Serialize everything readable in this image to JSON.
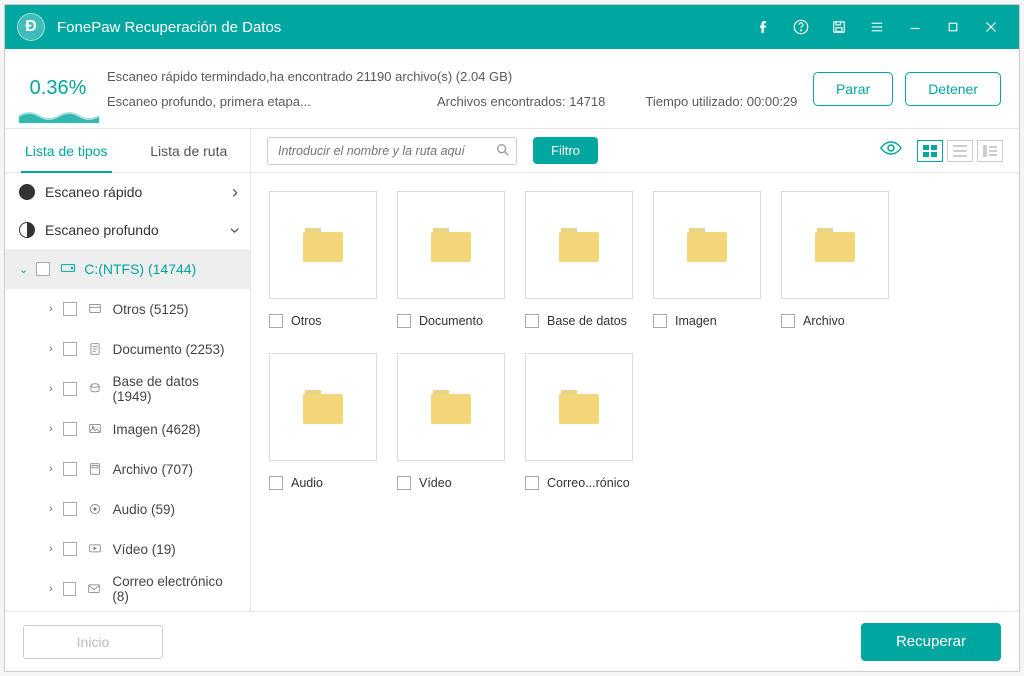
{
  "app": {
    "title": "FonePaw Recuperación de Datos"
  },
  "status": {
    "percent": "0.36%",
    "line1": "Escaneo rápido termindado,ha encontrado 21190 archivo(s) (2.04 GB)",
    "line2a": "Escaneo profundo, primera etapa...",
    "found_label": "Archivos encontrados: 14718",
    "time_label": "Tiempo utilizado: 00:00:29",
    "pause_label": "Parar",
    "stop_label": "Detener"
  },
  "sidebar": {
    "tab_types": "Lista de tipos",
    "tab_path": "Lista de ruta",
    "quick_scan": "Escaneo rápido",
    "deep_scan": "Escaneo profundo",
    "drive": "C:(NTFS) (14744)",
    "items": [
      {
        "label": "Otros (5125)"
      },
      {
        "label": "Documento (2253)"
      },
      {
        "label": "Base de datos (1949)"
      },
      {
        "label": "Imagen (4628)"
      },
      {
        "label": "Archivo (707)"
      },
      {
        "label": "Audio (59)"
      },
      {
        "label": "Vídeo (19)"
      },
      {
        "label": "Correo electrónico (8)"
      }
    ]
  },
  "toolbar": {
    "search_placeholder": "Introducir el nombre y la ruta aquí",
    "filter_label": "Filtro"
  },
  "folders": [
    {
      "label": "Otros"
    },
    {
      "label": "Documento"
    },
    {
      "label": "Base de datos"
    },
    {
      "label": "Imagen"
    },
    {
      "label": "Archivo"
    },
    {
      "label": "Audio"
    },
    {
      "label": "Vídeo"
    },
    {
      "label": "Correo...rónico"
    }
  ],
  "footer": {
    "start_label": "Inicio",
    "recover_label": "Recuperar"
  }
}
